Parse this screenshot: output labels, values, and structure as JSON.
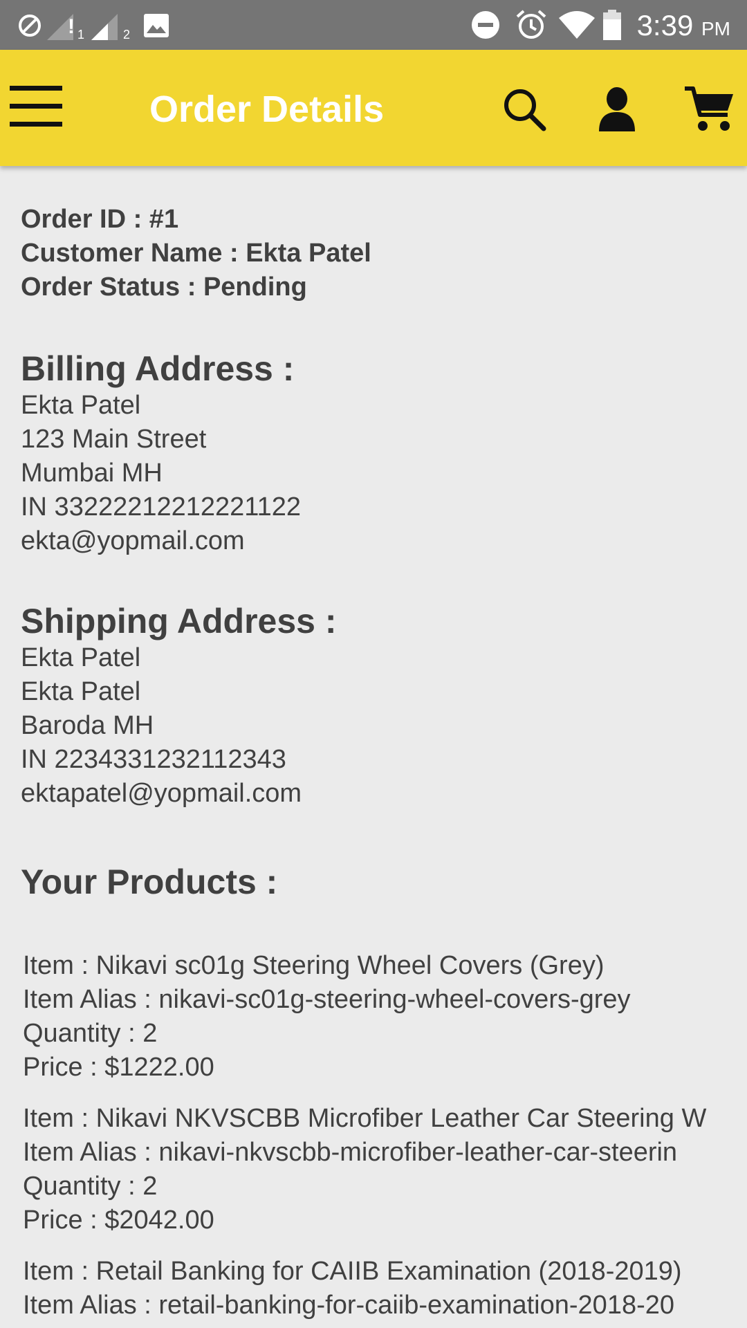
{
  "status_bar": {
    "time": "3:39",
    "ampm": "PM",
    "icons": [
      "do-not-disturb-off-icon",
      "signal-no-data-icon",
      "signal-sim2-icon",
      "image-notification-icon",
      "dnd-minus-icon",
      "alarm-icon",
      "wifi-icon",
      "battery-icon"
    ],
    "signal_badge_1": "!",
    "signal_badge_1_sub": "1",
    "signal_badge_2_sub": "2"
  },
  "app_bar": {
    "title": "Order Details",
    "background": "#f2d631",
    "icons": [
      "menu-icon",
      "search-icon",
      "account-icon",
      "cart-icon"
    ]
  },
  "order": {
    "id_line": "Order ID : #1",
    "customer_line": "Customer Name : Ekta Patel",
    "status_line": "Order Status : Pending"
  },
  "billing": {
    "heading": "Billing Address :",
    "lines": [
      "Ekta Patel",
      "123 Main Street",
      "Mumbai MH",
      "IN 33222212212221122",
      "ekta@yopmail.com"
    ]
  },
  "shipping": {
    "heading": "Shipping Address :",
    "lines": [
      "Ekta Patel",
      "Ekta Patel",
      "Baroda MH",
      "IN 2234331232112343",
      "ektapatel@yopmail.com"
    ]
  },
  "products": {
    "heading": "Your Products :",
    "items": [
      {
        "item": "Item : Nikavi sc01g Steering Wheel Covers (Grey)",
        "alias": "Item Alias : nikavi-sc01g-steering-wheel-covers-grey",
        "quantity": "Quantity : 2",
        "price": "Price : $1222.00"
      },
      {
        "item": "Item : Nikavi NKVSCBB Microfiber Leather Car Steering W",
        "alias": "Item Alias : nikavi-nkvscbb-microfiber-leather-car-steerin",
        "quantity": "Quantity : 2",
        "price": "Price : $2042.00"
      },
      {
        "item": "Item : Retail Banking for CAIIB Examination (2018-2019)",
        "alias": "Item Alias : retail-banking-for-caiib-examination-2018-20",
        "quantity": "",
        "price": ""
      }
    ]
  }
}
